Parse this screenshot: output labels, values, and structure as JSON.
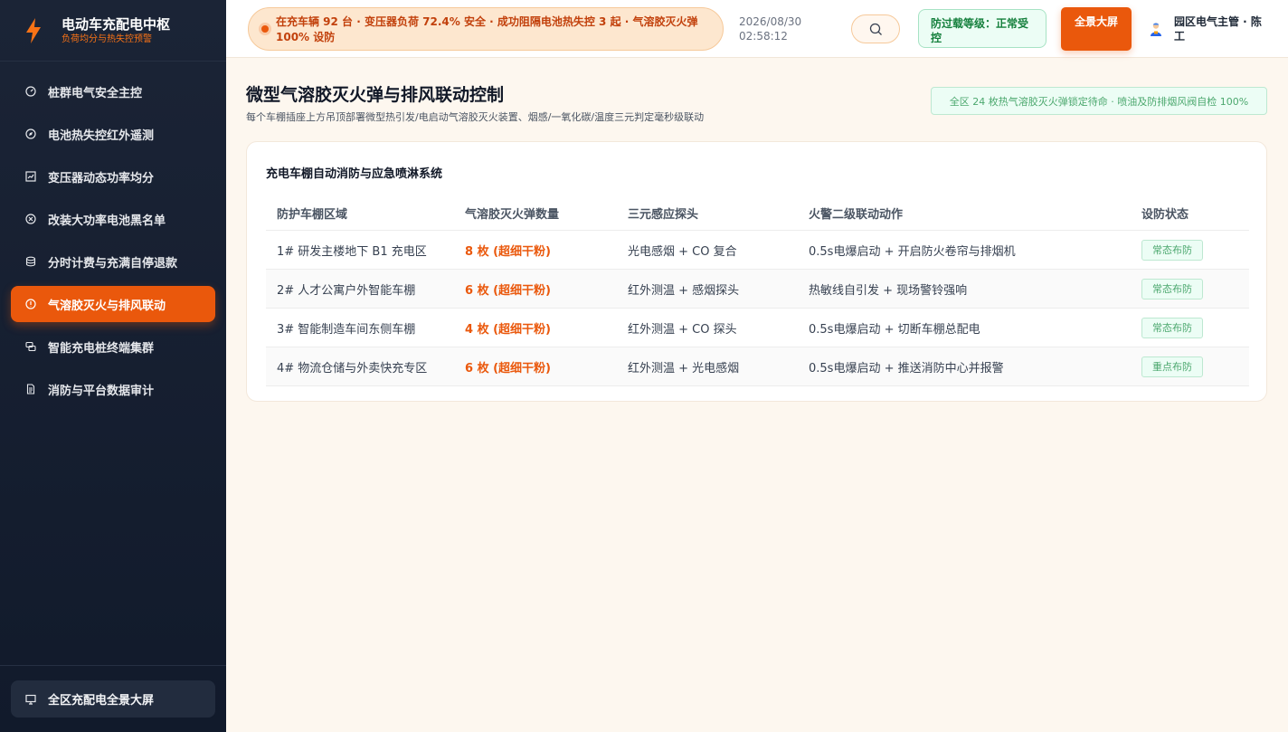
{
  "brand": {
    "title": "电动车充配电中枢",
    "subtitle": "负荷均分与热失控预警"
  },
  "sidebar": {
    "items": [
      {
        "label": "桩群电气安全主控",
        "icon": "gauge-icon"
      },
      {
        "label": "电池热失控红外遥测",
        "icon": "compass-icon"
      },
      {
        "label": "变压器动态功率均分",
        "icon": "chart-icon"
      },
      {
        "label": "改装大功率电池黑名单",
        "icon": "ban-icon"
      },
      {
        "label": "分时计费与充满自停退款",
        "icon": "database-icon"
      },
      {
        "label": "气溶胶灭火与排风联动",
        "icon": "alert-icon"
      },
      {
        "label": "智能充电桩终端集群",
        "icon": "cluster-icon"
      },
      {
        "label": "消防与平台数据审计",
        "icon": "document-icon"
      }
    ],
    "footer_button": "全区充配电全景大屏"
  },
  "header": {
    "ticker": "在充车辆 92 台 · 变压器负荷 72.4% 安全 · 成功阻隔电池热失控 3 起 · 气溶胶灭火弹 100% 设防",
    "date": "2026/08/30",
    "time": "02:58:12",
    "load_level": "防过载等级：正常受控",
    "fullscreen_label": "全景大屏",
    "user_name": "园区电气主管 · 陈工"
  },
  "main": {
    "title": "微型气溶胶灭火弹与排风联动控制",
    "subtitle": "每个车棚插座上方吊顶部署微型热引发/电启动气溶胶灭火装置、烟感/一氧化碳/温度三元判定毫秒级联动",
    "status_pill": "全区 24 枚热气溶胶灭火弹锁定待命 · 喷油及防排烟风阀自检 100%"
  },
  "card": {
    "title": "充电车棚自动消防与应急喷淋系统",
    "columns": [
      "防护车棚区域",
      "气溶胶灭火弹数量",
      "三元感应探头",
      "火警二级联动动作",
      "设防状态"
    ],
    "rows": [
      {
        "zone": "1# 研发主楼地下 B1 充电区",
        "qty": "8 枚 (超细干粉)",
        "sensor": "光电感烟 + CO 复合",
        "action": "0.5s电爆启动 + 开启防火卷帘与排烟机",
        "status": "常态布防"
      },
      {
        "zone": "2# 人才公寓户外智能车棚",
        "qty": "6 枚 (超细干粉)",
        "sensor": "红外测温 + 感烟探头",
        "action": "热敏线自引发 + 现场警铃强响",
        "status": "常态布防"
      },
      {
        "zone": "3# 智能制造车间东侧车棚",
        "qty": "4 枚 (超细干粉)",
        "sensor": "红外测温 + CO 探头",
        "action": "0.5s电爆启动 + 切断车棚总配电",
        "status": "常态布防"
      },
      {
        "zone": "4# 物流仓储与外卖快充专区",
        "qty": "6 枚 (超细干粉)",
        "sensor": "红外测温 + 光电感烟",
        "action": "0.5s电爆启动 + 推送消防中心并报警",
        "status": "重点布防"
      }
    ]
  },
  "colors": {
    "accent": "#ea580c",
    "sidebar_bg": "#111a2b",
    "success": "#4ca86e"
  }
}
